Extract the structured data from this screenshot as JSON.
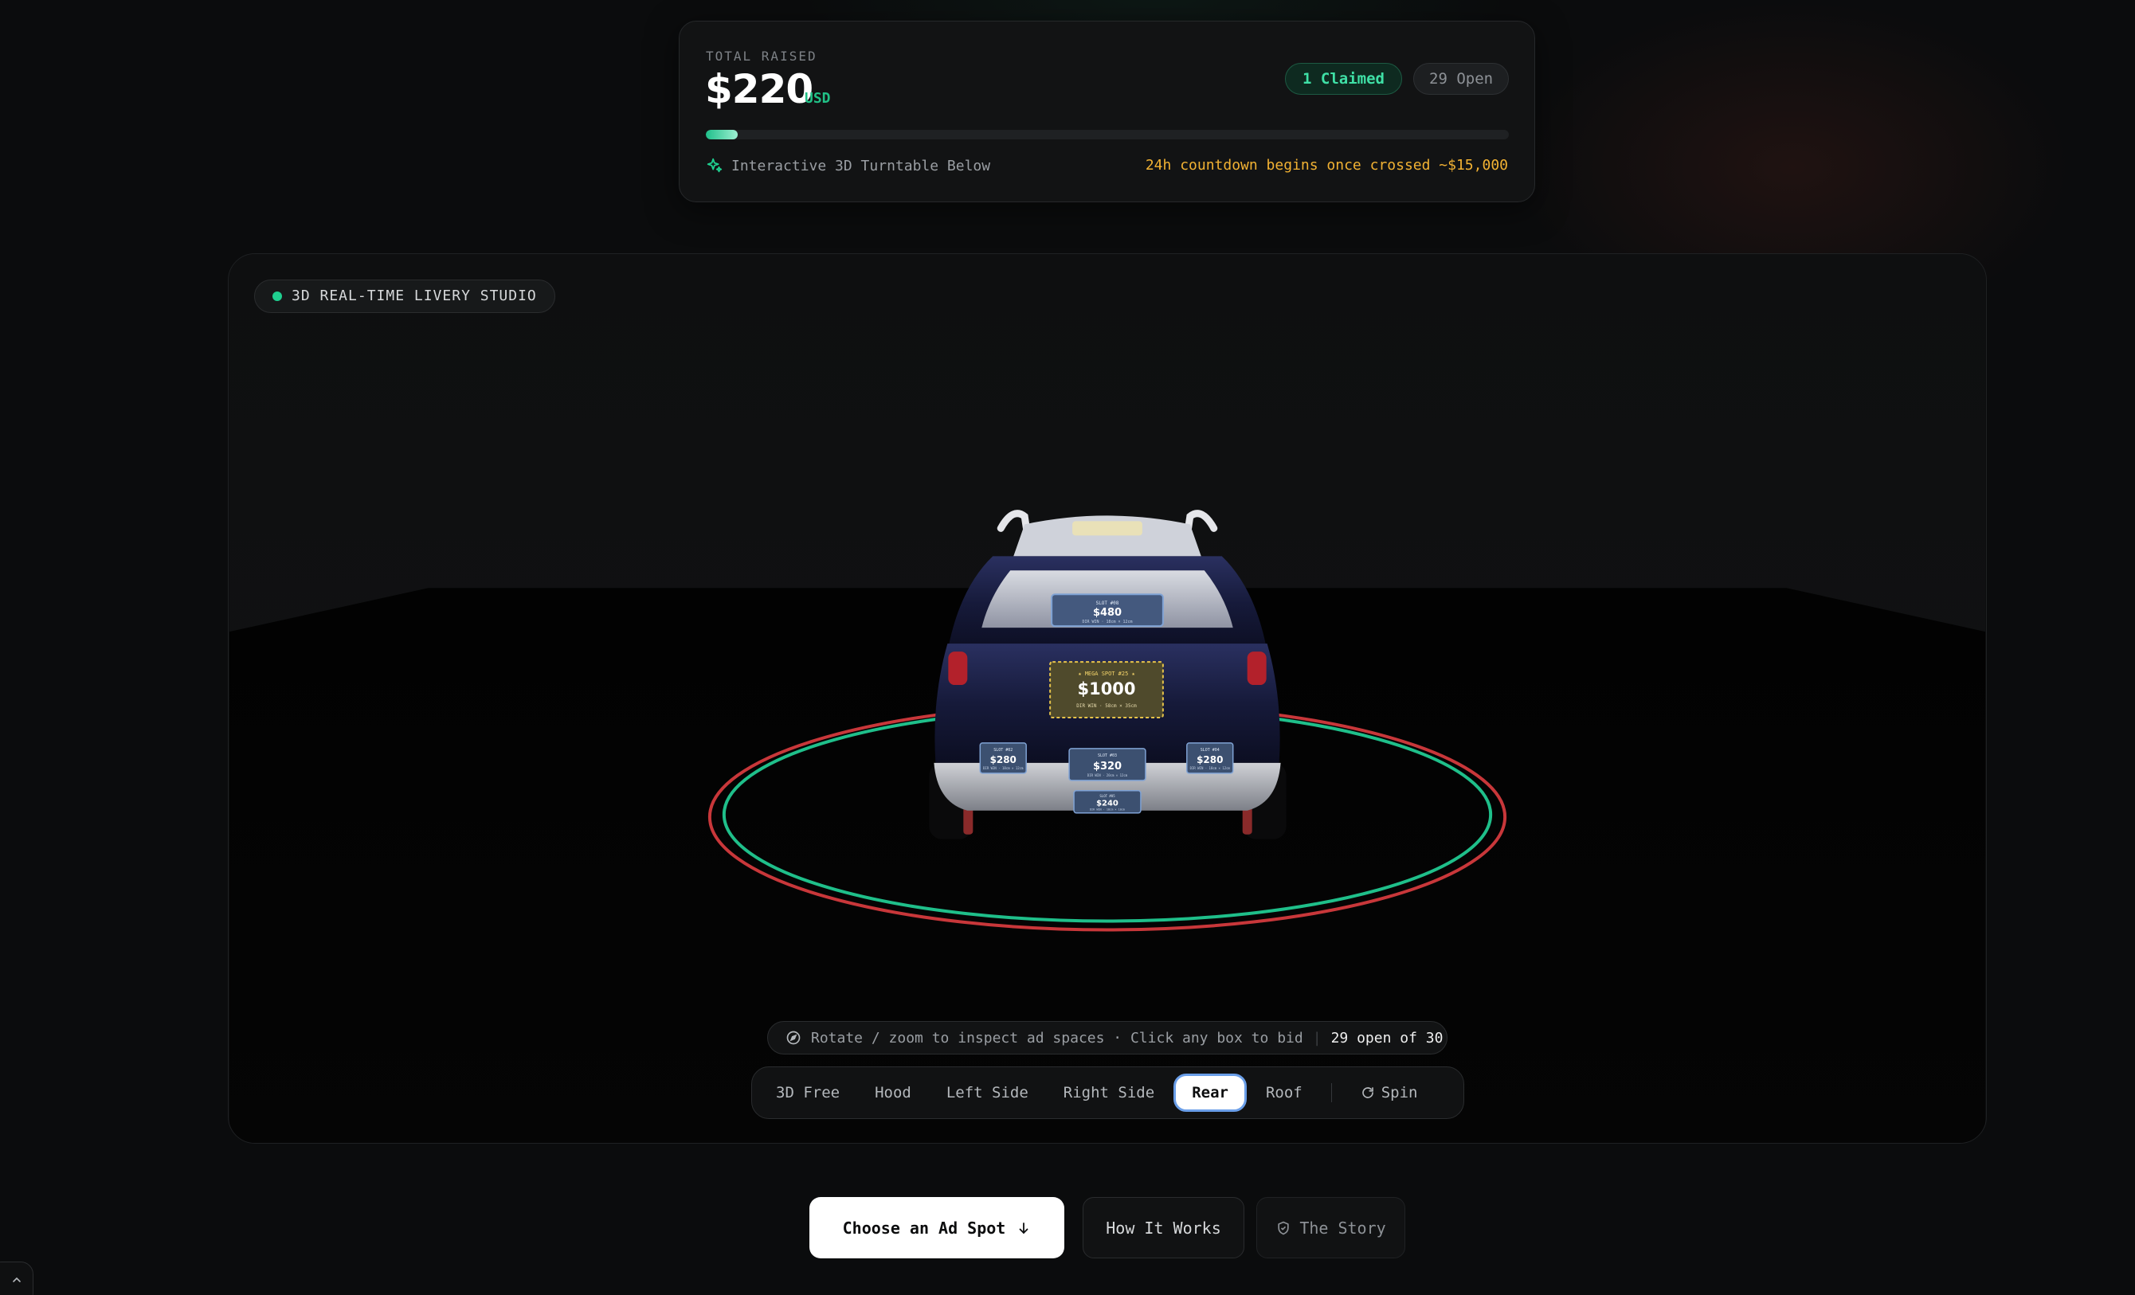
{
  "funding": {
    "label": "TOTAL RAISED",
    "amount": "$220",
    "currency": "USD",
    "claimed_badge": "1 Claimed",
    "open_badge": "29 Open",
    "progress_fraction": 0.04,
    "turntable_note": "Interactive 3D Turntable Below",
    "countdown_note": "24h countdown begins once crossed ~$15,000"
  },
  "studio": {
    "tag": "3D REAL-TIME LIVERY STUDIO",
    "car": {
      "spot_window": {
        "title": "SLOT #08",
        "price": "$480",
        "meta": "DIR WIN · 18cm × 12cm"
      },
      "spot_mega": {
        "title": "★ MEGA SPOT #25 ★",
        "price": "$1000",
        "meta": "DIR WIN · 58cm × 35cm"
      },
      "spot_left": {
        "title": "SLOT #02",
        "price": "$280",
        "meta": "DIR WIN · 18cm × 12cm"
      },
      "spot_center": {
        "title": "SLOT #03",
        "price": "$320",
        "meta": "DIR WIN · 20cm × 12cm"
      },
      "spot_right": {
        "title": "SLOT #04",
        "price": "$280",
        "meta": "DIR WIN · 18cm × 12cm"
      },
      "spot_plate": {
        "title": "SLOT #05",
        "price": "$240",
        "meta": "DIR WIN · 18cm × 10cm"
      }
    },
    "hint": {
      "text": "Rotate / zoom to inspect ad spaces · Click any box to bid",
      "count": "29 open of 30"
    },
    "views": [
      {
        "label": "3D Free",
        "active": false
      },
      {
        "label": "Hood",
        "active": false
      },
      {
        "label": "Left Side",
        "active": false
      },
      {
        "label": "Right Side",
        "active": false
      },
      {
        "label": "Rear",
        "active": true
      },
      {
        "label": "Roof",
        "active": false
      }
    ],
    "spin_label": "Spin"
  },
  "cta": {
    "primary": "Choose an Ad Spot",
    "secondary": "How It Works",
    "tertiary": "The Story"
  },
  "colors": {
    "accent_green": "#1fcf8f",
    "warning_amber": "#f2b233",
    "ring_red": "#c8373a",
    "ring_green": "#1fbf8a",
    "car_body": "#141a3a"
  },
  "icons": [
    "sparkle-icon",
    "compass-icon",
    "refresh-icon",
    "arrow-down-icon",
    "shield-check-icon",
    "chevron-up-icon"
  ]
}
